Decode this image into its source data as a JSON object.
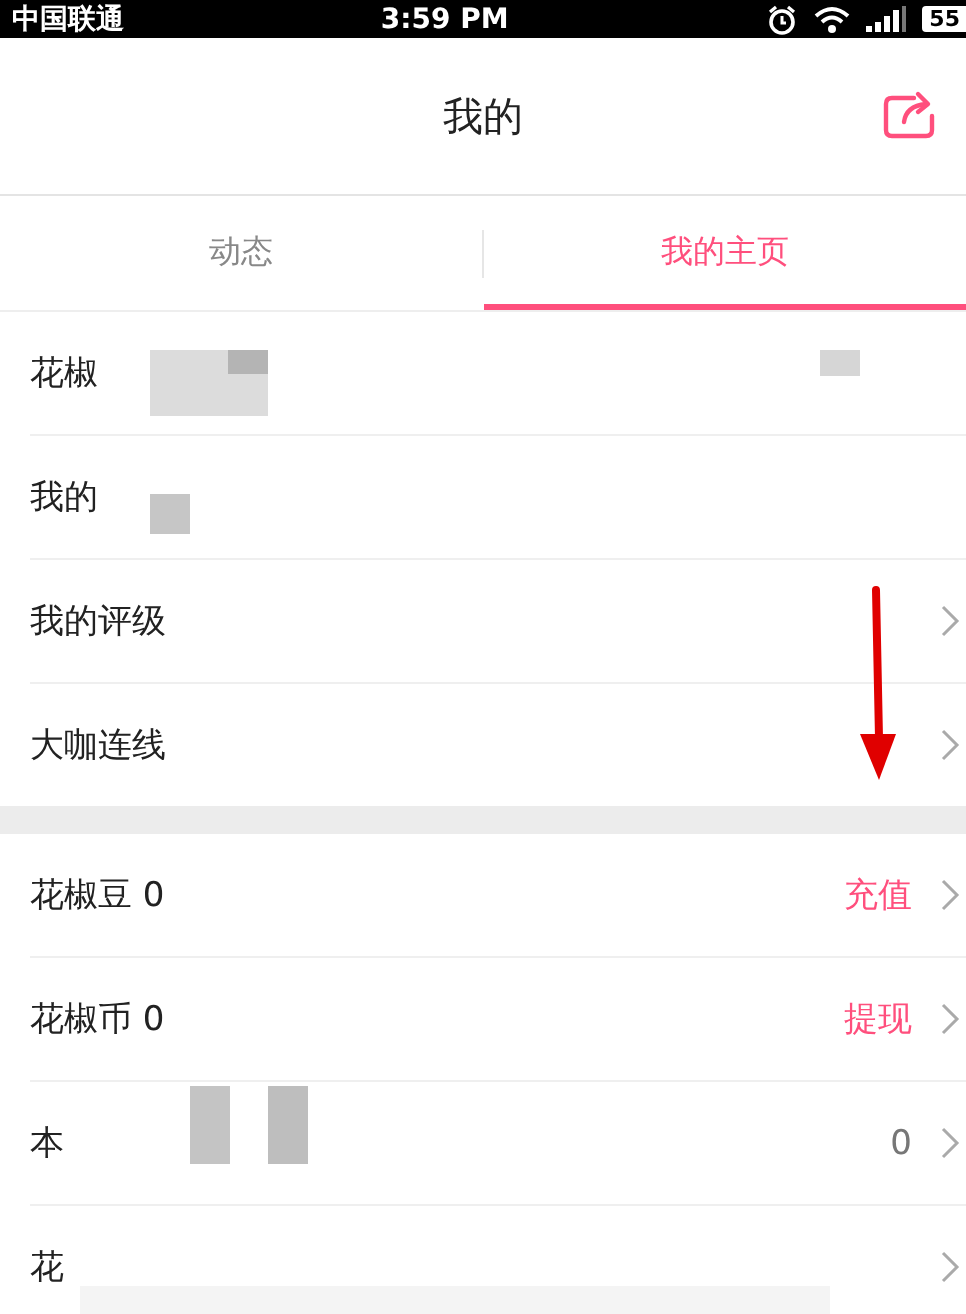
{
  "status_bar": {
    "carrier": "中国联通",
    "time": "3:59 PM",
    "battery": "55"
  },
  "header": {
    "title": "我的"
  },
  "tabs": [
    {
      "label": "动态",
      "selected": false
    },
    {
      "label": "我的主页",
      "selected": true
    }
  ],
  "sections": [
    {
      "rows": [
        {
          "label": "花椒",
          "chevron": false
        },
        {
          "label": "我的",
          "chevron": false
        },
        {
          "label": "我的评级",
          "chevron": true
        },
        {
          "label": "大咖连线",
          "chevron": true
        }
      ]
    },
    {
      "rows": [
        {
          "label": "花椒豆 0",
          "action": "充值",
          "chevron": true
        },
        {
          "label": "花椒币 0",
          "action": "提现",
          "chevron": true
        },
        {
          "label": "本",
          "value": "0",
          "chevron": true
        },
        {
          "label": "花",
          "chevron": true
        }
      ]
    }
  ]
}
